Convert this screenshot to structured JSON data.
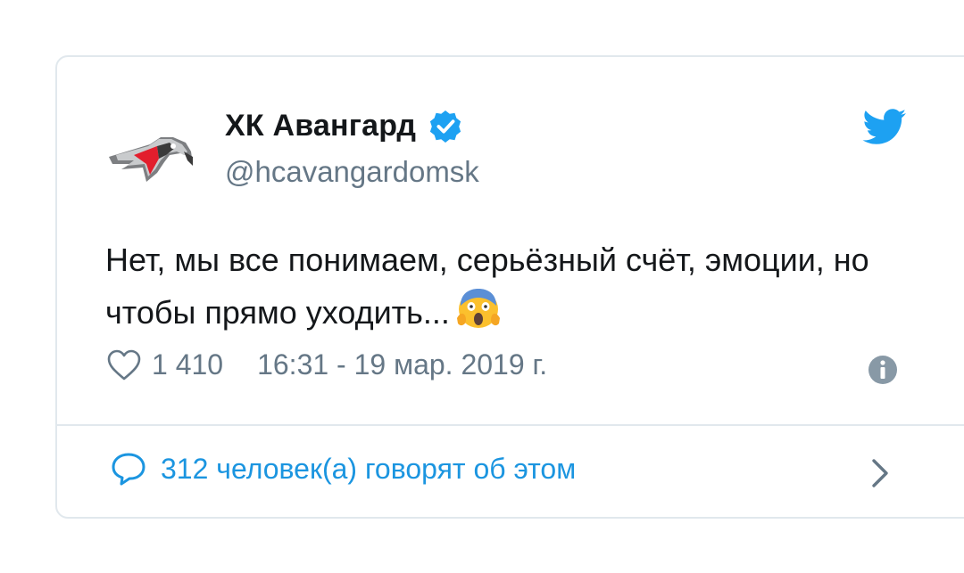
{
  "tweet": {
    "display_name": "ХК Авангард",
    "handle": "@hcavangardomsk",
    "text": "Нет, мы все понимаем, серьёзный счёт, эмоции, но чтобы прямо уходить...",
    "likes": "1 410",
    "timestamp": "16:31 - 19 мар. 2019 г.",
    "discussion": "312 человек(а) говорят об этом"
  },
  "icons": {
    "avatar": "avangard-eagle-logo",
    "verified": "verified-badge-icon",
    "platform": "twitter-bird-icon",
    "emoji": "face-screaming-in-fear-emoji",
    "like": "heart-icon",
    "info": "info-icon",
    "reply": "speech-bubble-icon",
    "chevron": "chevron-right-icon"
  },
  "colors": {
    "text": "#14171a",
    "secondary": "#657786",
    "accent": "#1b95e0",
    "border": "#e1e8ed"
  }
}
